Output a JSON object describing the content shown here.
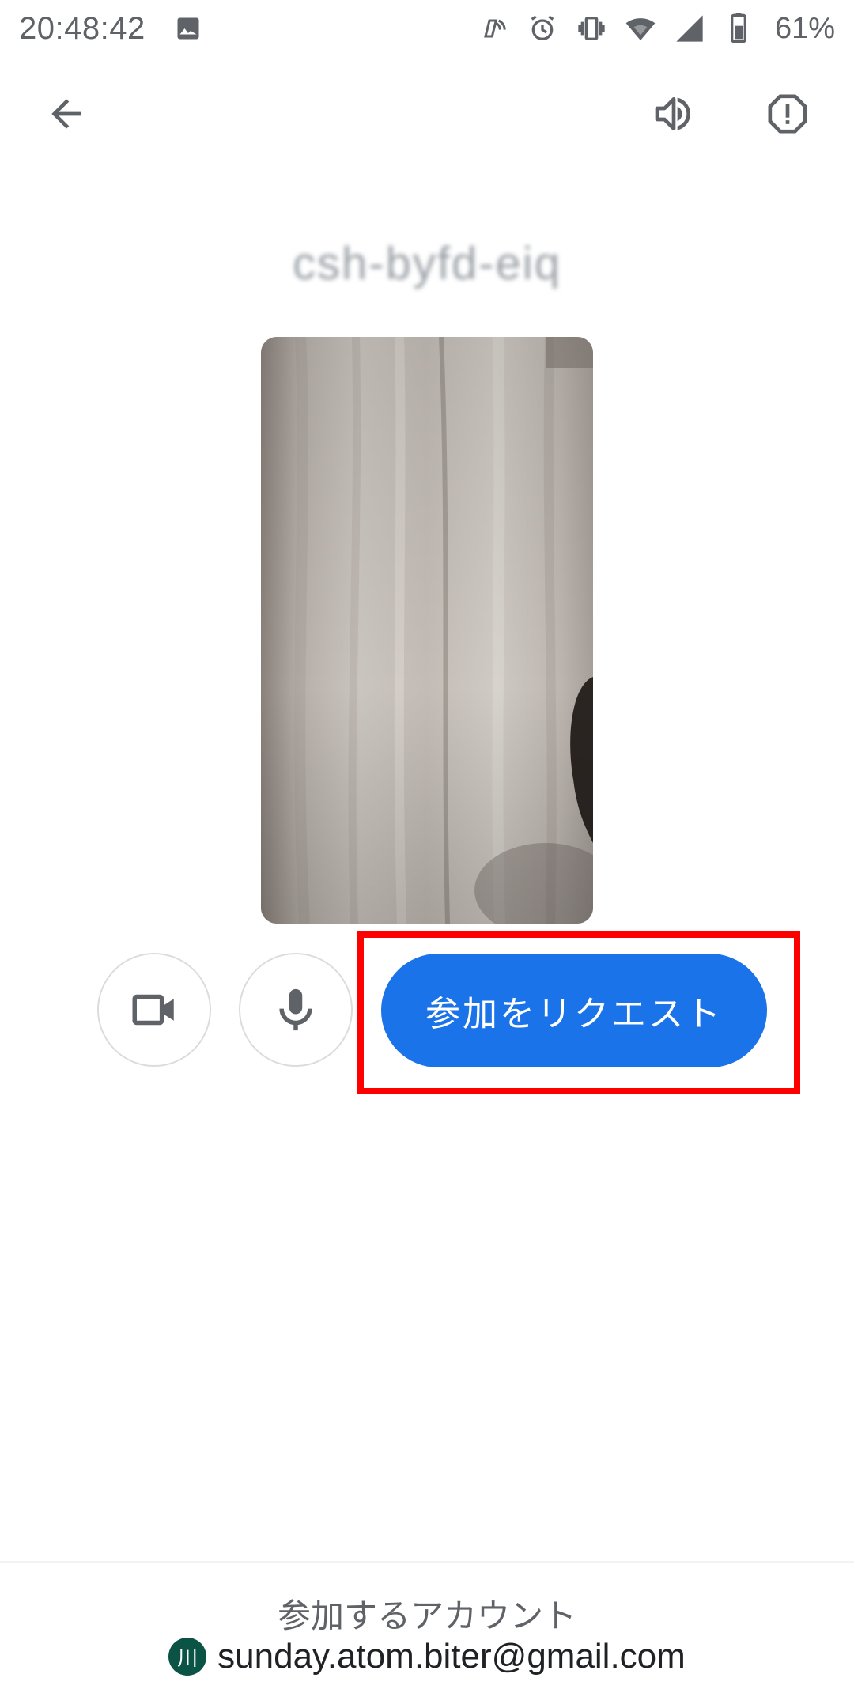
{
  "status_bar": {
    "time": "20:48:42",
    "battery_percent": "61%",
    "icons": [
      "image-icon",
      "nfc-icon",
      "alarm-icon",
      "vibrate-icon",
      "wifi-icon",
      "signal-icon",
      "battery-icon"
    ]
  },
  "app_bar": {
    "back_icon": "arrow-back-icon",
    "speaker_icon": "volume-icon",
    "report_icon": "report-issue-icon"
  },
  "meeting": {
    "code": "csh-byfd-eiq"
  },
  "controls": {
    "camera_icon": "videocam-icon",
    "mic_icon": "mic-icon",
    "join_button_label": "参加をリクエスト"
  },
  "footer": {
    "account_label": "参加するアカウント",
    "avatar_initial": "川",
    "account_email": "sunday.atom.biter@gmail.com"
  },
  "colors": {
    "join_button": "#1a73e8",
    "highlight": "#ff0000",
    "avatar": "#0b5345"
  }
}
